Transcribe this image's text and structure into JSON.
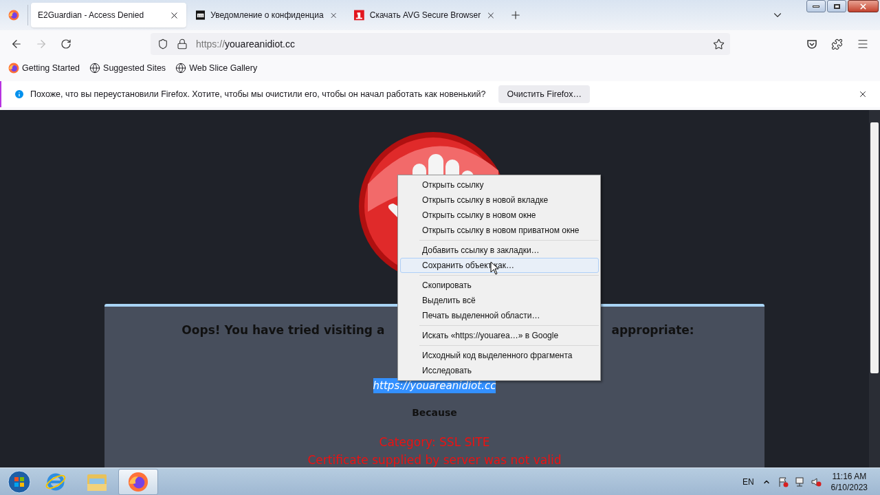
{
  "tabs": [
    {
      "title": "E2Guardian - Access Denied",
      "kind": "plain",
      "selected": true
    },
    {
      "title": "Уведомление о конфиденциа",
      "kind": "m",
      "selected": false
    },
    {
      "title": "Скачать AVG Secure Browser",
      "kind": "one",
      "selected": false
    }
  ],
  "address_bar": {
    "scheme": "https://",
    "host": "youareanidiot.cc"
  },
  "bookmarks": [
    {
      "label": "Getting Started",
      "kind": "firefox"
    },
    {
      "label": "Suggested Sites",
      "kind": "globe"
    },
    {
      "label": "Web Slice Gallery",
      "kind": "globe"
    }
  ],
  "notification": {
    "message": "Похоже, что вы переустановили Firefox. Хотите, чтобы мы очистили его, чтобы он начал работать как новенький?",
    "button": "Очистить Firefox…"
  },
  "page": {
    "heading_left": "Oops! You have tried visiting a",
    "heading_right": "appropriate:",
    "url": {
      "text": "https://youareanidiot.cc",
      "selected": true
    },
    "because": "Because",
    "category": "Category: SSL SITE",
    "reason": "Certificate supplied by server was not valid"
  },
  "context_menu": [
    [
      {
        "label": "Открыть ссылку",
        "selected": false
      },
      {
        "label": "Открыть ссылку в новой вкладке",
        "selected": false
      },
      {
        "label": "Открыть ссылку в новом окне",
        "selected": false
      },
      {
        "label": "Открыть ссылку в новом приватном окне",
        "selected": false
      }
    ],
    [
      {
        "label": "Добавить ссылку в закладки…",
        "selected": false
      },
      {
        "label": "Сохранить объект как…",
        "selected": true
      }
    ],
    [
      {
        "label": "Скопировать",
        "selected": false
      },
      {
        "label": "Выделить всё",
        "selected": false
      },
      {
        "label": "Печать выделенной области…",
        "selected": false
      }
    ],
    [
      {
        "label": "Искать «https://youarea…» в Google",
        "selected": false
      }
    ],
    [
      {
        "label": "Исходный код выделенного фрагмента",
        "selected": false
      },
      {
        "label": "Исследовать",
        "selected": false
      }
    ]
  ],
  "taskbar": {
    "apps": [
      {
        "kind": "ie",
        "selected": false
      },
      {
        "kind": "folder",
        "selected": false
      },
      {
        "kind": "firefox",
        "selected": true
      }
    ],
    "language": "EN",
    "time": "11:16 AM",
    "date": "6/10/2023"
  }
}
